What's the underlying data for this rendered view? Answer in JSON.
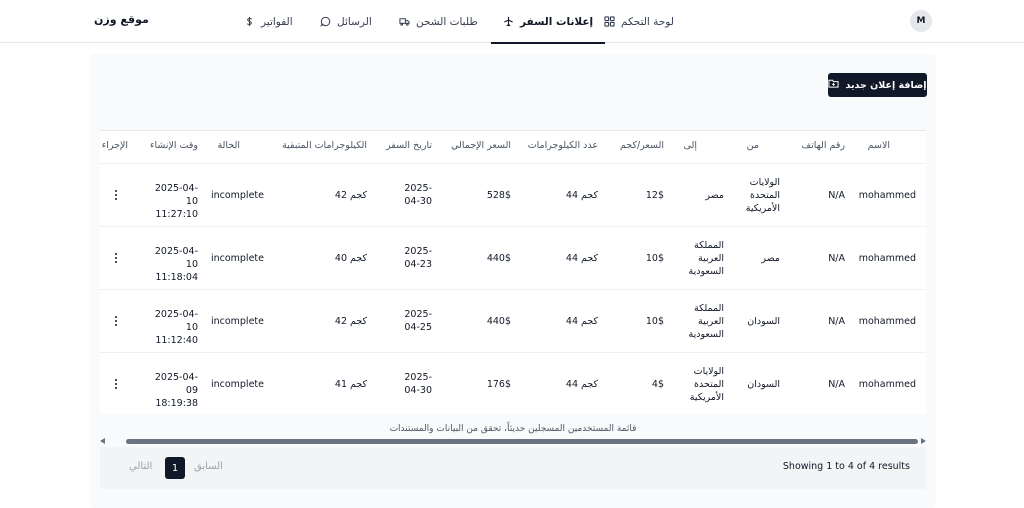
{
  "nav": {
    "avatar": "M",
    "brand": "موقع وزن",
    "items": [
      {
        "label": "لوحة التحكم",
        "icon": "grid-icon"
      },
      {
        "label": "إعلانات السفر",
        "icon": "plane-icon",
        "active": true
      },
      {
        "label": "طلبات الشحن",
        "icon": "truck-icon"
      },
      {
        "label": "الرسائل",
        "icon": "message-icon"
      },
      {
        "label": "الفواتير",
        "icon": "dollar-icon"
      }
    ]
  },
  "toolbar": {
    "add_label": "إضافة إعلان جديد",
    "add_icon": "add-folder-icon"
  },
  "table": {
    "headers": {
      "name": "الاسم",
      "phone": "رقم الهاتف",
      "from": "من",
      "to": "إلى",
      "price_per_kg": "السعر/كجم",
      "kg_count": "عدد الكيلوجرامات",
      "total_price": "السعر الإجمالي",
      "travel_date": "تاريخ السفر",
      "remaining_kg": "الكيلوجرامات المتبقية",
      "status": "الحالة",
      "created_at": "وقت الإنشاء",
      "actions": "الإجراء"
    },
    "rows": [
      {
        "name": "mohammed",
        "phone": "N/A",
        "from": "الولايات المتحدة الأمريكية",
        "to": "مصر",
        "price_per_kg": "12$",
        "kg_count": "44 كجم",
        "total_price": "528$",
        "travel_date": "2025-04-30",
        "remaining_kg": "42 كجم",
        "status": "incomplete",
        "created_at": "2025-04-10 11:27:10"
      },
      {
        "name": "mohammed",
        "phone": "N/A",
        "from": "مصر",
        "to": "المملكة العربية السعودية",
        "price_per_kg": "10$",
        "kg_count": "44 كجم",
        "total_price": "440$",
        "travel_date": "2025-04-23",
        "remaining_kg": "40 كجم",
        "status": "incomplete",
        "created_at": "2025-04-10 11:18:04"
      },
      {
        "name": "mohammed",
        "phone": "N/A",
        "from": "السودان",
        "to": "المملكة العربية السعودية",
        "price_per_kg": "10$",
        "kg_count": "44 كجم",
        "total_price": "440$",
        "travel_date": "2025-04-25",
        "remaining_kg": "42 كجم",
        "status": "incomplete",
        "created_at": "2025-04-10 11:12:40"
      },
      {
        "name": "mohammed",
        "phone": "N/A",
        "from": "السودان",
        "to": "الولايات المتحدة الأمريكية",
        "price_per_kg": "4$",
        "kg_count": "44 كجم",
        "total_price": "176$",
        "travel_date": "2025-04-30",
        "remaining_kg": "41 كجم",
        "status": "incomplete",
        "created_at": "2025-04-09 18:19:38"
      }
    ],
    "caption": "قائمة المستخدمين المسجلين حديثاً، تحقق من البيانات والمستندات"
  },
  "pagination": {
    "showing": "Showing 1 to 4 of 4 results",
    "prev": "السابق",
    "page": "1",
    "next": "التالي"
  }
}
